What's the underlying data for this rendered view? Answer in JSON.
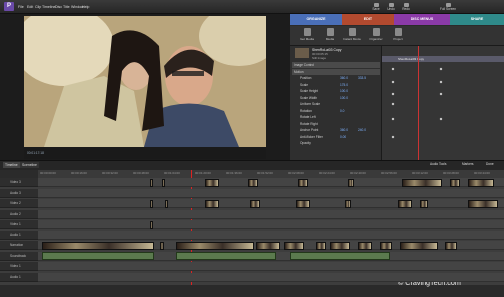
{
  "menu": [
    "File",
    "Edit",
    "Clip",
    "Timeline",
    "Disc",
    "Title",
    "Window",
    "Help"
  ],
  "toolbar_right": [
    "Save",
    "Undo",
    "Redo",
    "Full Screen"
  ],
  "tabs": [
    {
      "label": "ORGANIZE",
      "color": "#4a6fb8"
    },
    {
      "label": "EDIT",
      "color": "#b24a2f"
    },
    {
      "label": "DISC MENUS",
      "color": "#8b3aa8"
    },
    {
      "label": "SHARE",
      "color": "#2f8a8a"
    }
  ],
  "quick": [
    "Get Media",
    "Media",
    "Instant Movie",
    "Organizer",
    "Project"
  ],
  "clip": {
    "name": "ShenRoLai03 Copy",
    "sub": "00:00:05:15",
    "type": "Still Image"
  },
  "monitor_time": "00:01:17:18",
  "props": [
    {
      "label": "Image Control",
      "v1": "",
      "v2": ""
    },
    {
      "label": "Motion",
      "v1": "",
      "v2": ""
    },
    {
      "label": "Position",
      "v1": "360.0",
      "v2": "333.5"
    },
    {
      "label": "Scale",
      "v1": "175.0",
      "v2": ""
    },
    {
      "label": "Scale Height",
      "v1": "100.0",
      "v2": ""
    },
    {
      "label": "Scale Width",
      "v1": "100.0",
      "v2": ""
    },
    {
      "label": "Uniform Scale",
      "v1": "",
      "v2": ""
    },
    {
      "label": "Rotation",
      "v1": "0.0",
      "v2": ""
    },
    {
      "label": "Rotate Left",
      "v1": "",
      "v2": ""
    },
    {
      "label": "Rotate Right",
      "v1": "",
      "v2": ""
    },
    {
      "label": "Anchor Point",
      "v1": "360.0",
      "v2": "240.0"
    },
    {
      "label": "Anti-flicker Filter",
      "v1": "0.00",
      "v2": ""
    },
    {
      "label": "Opacity",
      "v1": "",
      "v2": ""
    }
  ],
  "kf_clip": "ShenRoLai03 Copy",
  "timeline_tabs": [
    "Timeline",
    "Sceneline"
  ],
  "timeline_right": [
    "Audio Tools",
    "Markers",
    "Done"
  ],
  "ruler": [
    "00:00:00:00",
    "00:00:16:00",
    "00:00:32:00",
    "00:00:48:00",
    "00:01:04:00",
    "00:01:20:00",
    "00:01:36:00",
    "00:01:52:00",
    "00:02:08:00",
    "00:02:24:00",
    "00:02:40:00",
    "00:02:56:00",
    "00:03:12:00",
    "00:03:28:00",
    "00:03:44:00"
  ],
  "tracks": [
    "Video 3",
    "Audio 3",
    "Video 2",
    "Audio 2",
    "Video 1",
    "Audio 1",
    "Narration",
    "Soundtrack",
    "Video 1",
    "Audio 1"
  ],
  "watermark": "© CravingTech.com"
}
